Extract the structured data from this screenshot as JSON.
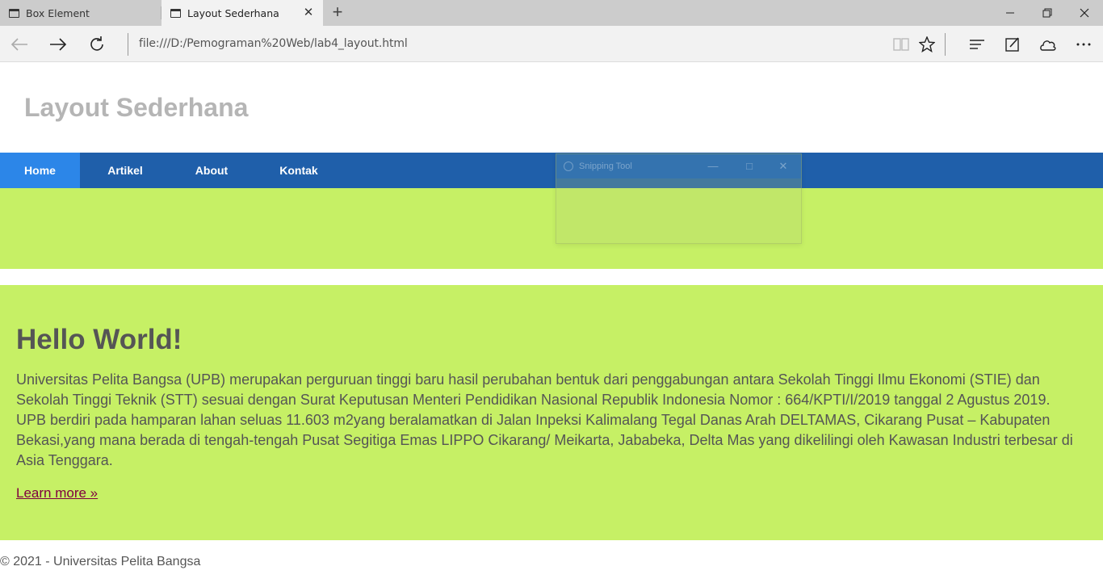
{
  "browser": {
    "tabs": [
      {
        "title": "Box Element",
        "active": false
      },
      {
        "title": "Layout Sederhana",
        "active": true
      }
    ],
    "url": "file:///D:/Pemograman%20Web/lab4_layout.html"
  },
  "site": {
    "title": "Layout Sederhana",
    "nav": [
      {
        "label": "Home",
        "active": true
      },
      {
        "label": "Artikel",
        "active": false
      },
      {
        "label": "About",
        "active": false
      },
      {
        "label": "Kontak",
        "active": false
      }
    ],
    "overlay_window_title": "Snipping Tool",
    "content": {
      "heading": "Hello World!",
      "paragraph": "Universitas Pelita Bangsa (UPB) merupakan perguruan tinggi baru hasil perubahan bentuk dari penggabungan antara Sekolah Tinggi Ilmu Ekonomi (STIE) dan Sekolah Tinggi Teknik (STT) sesuai dengan Surat Keputusan Menteri Pendidikan Nasional Republik Indonesia Nomor : 664/KPTI/I/2019 tanggal 2 Agustus 2019. UPB berdiri pada hamparan lahan seluas 11.603 m2yang beralamatkan di Jalan Inpeksi Kalimalang Tegal Danas Arah DELTAMAS, Cikarang Pusat – Kabupaten Bekasi,yang mana berada di tengah-tengah Pusat Segitiga Emas LIPPO Cikarang/ Meikarta, Jababeka, Delta Mas yang dikelilingi oleh Kawasan Industri terbesar di Asia Tenggara.",
      "link": "Learn more »"
    },
    "footer": "© 2021 - Universitas Pelita Bangsa"
  },
  "colors": {
    "navbar": "#1f5faa",
    "nav_active": "#2c86e8",
    "hero": "#c6f065",
    "title_gray": "#b5b5b5"
  }
}
